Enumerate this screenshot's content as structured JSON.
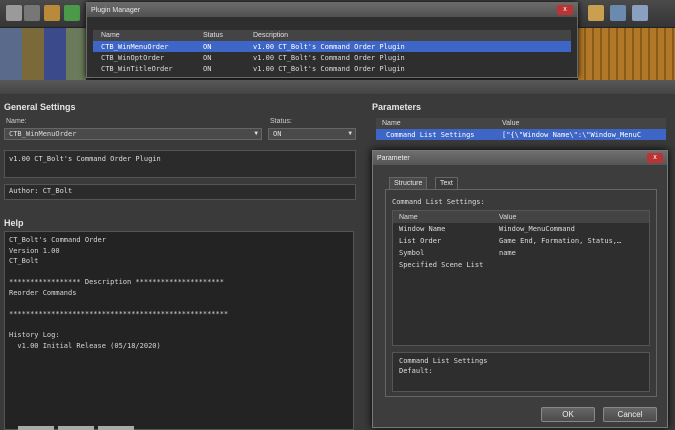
{
  "plugin_manager": {
    "title": "Plugin Manager",
    "close_label": "x",
    "columns": [
      "Name",
      "Status",
      "Description"
    ],
    "rows": [
      {
        "name": "CTB_WinMenuOrder",
        "status": "ON",
        "description": "v1.00 CT_Bolt's Command Order Plugin"
      },
      {
        "name": "CTB_WinOptOrder",
        "status": "ON",
        "description": "v1.00 CT_Bolt's Command Order Plugin"
      },
      {
        "name": "CTB_WinTitleOrder",
        "status": "ON",
        "description": "v1.00 CT_Bolt's Command Order Plugin"
      }
    ]
  },
  "general": {
    "title": "General Settings",
    "name_label": "Name:",
    "name_value": "CTB_WinMenuOrder",
    "status_label": "Status:",
    "status_value": "ON",
    "description": "v1.00 CT_Bolt's Command Order Plugin",
    "author": "Author: CT_Bolt"
  },
  "help": {
    "title": "Help",
    "lines": [
      "CT_Bolt's Command Order",
      "Version 1.00",
      "CT_Bolt",
      "",
      "***************** Description *********************",
      "Reorder Commands",
      "",
      "****************************************************",
      "",
      "History Log:",
      "  v1.00 Initial Release (05/18/2020)"
    ]
  },
  "parameters": {
    "title": "Parameters",
    "columns": [
      "Name",
      "Value"
    ],
    "rows": [
      {
        "name": "Command List Settings",
        "value": "[\"{\\\"Window Name\\\":\\\"Window_MenuC"
      }
    ]
  },
  "param_dialog": {
    "title": "Parameter",
    "close_label": "x",
    "tabs": [
      "Structure",
      "Text"
    ],
    "section_label": "Command List Settings:",
    "columns": [
      "Name",
      "Value"
    ],
    "rows": [
      {
        "name": "Window Name",
        "value": "Window_MenuCommand"
      },
      {
        "name": "List Order",
        "value": "Game End, Formation, Status,…"
      },
      {
        "name": "Symbol",
        "value": "name"
      },
      {
        "name": "Specified Scene List",
        "value": ""
      }
    ],
    "desc_title": "Command List Settings",
    "desc_default": "Default:",
    "ok_label": "OK",
    "cancel_label": "Cancel"
  },
  "colors": {
    "selection": "#3e66c7",
    "panel": "#3a3a3a",
    "close": "#b33333"
  }
}
